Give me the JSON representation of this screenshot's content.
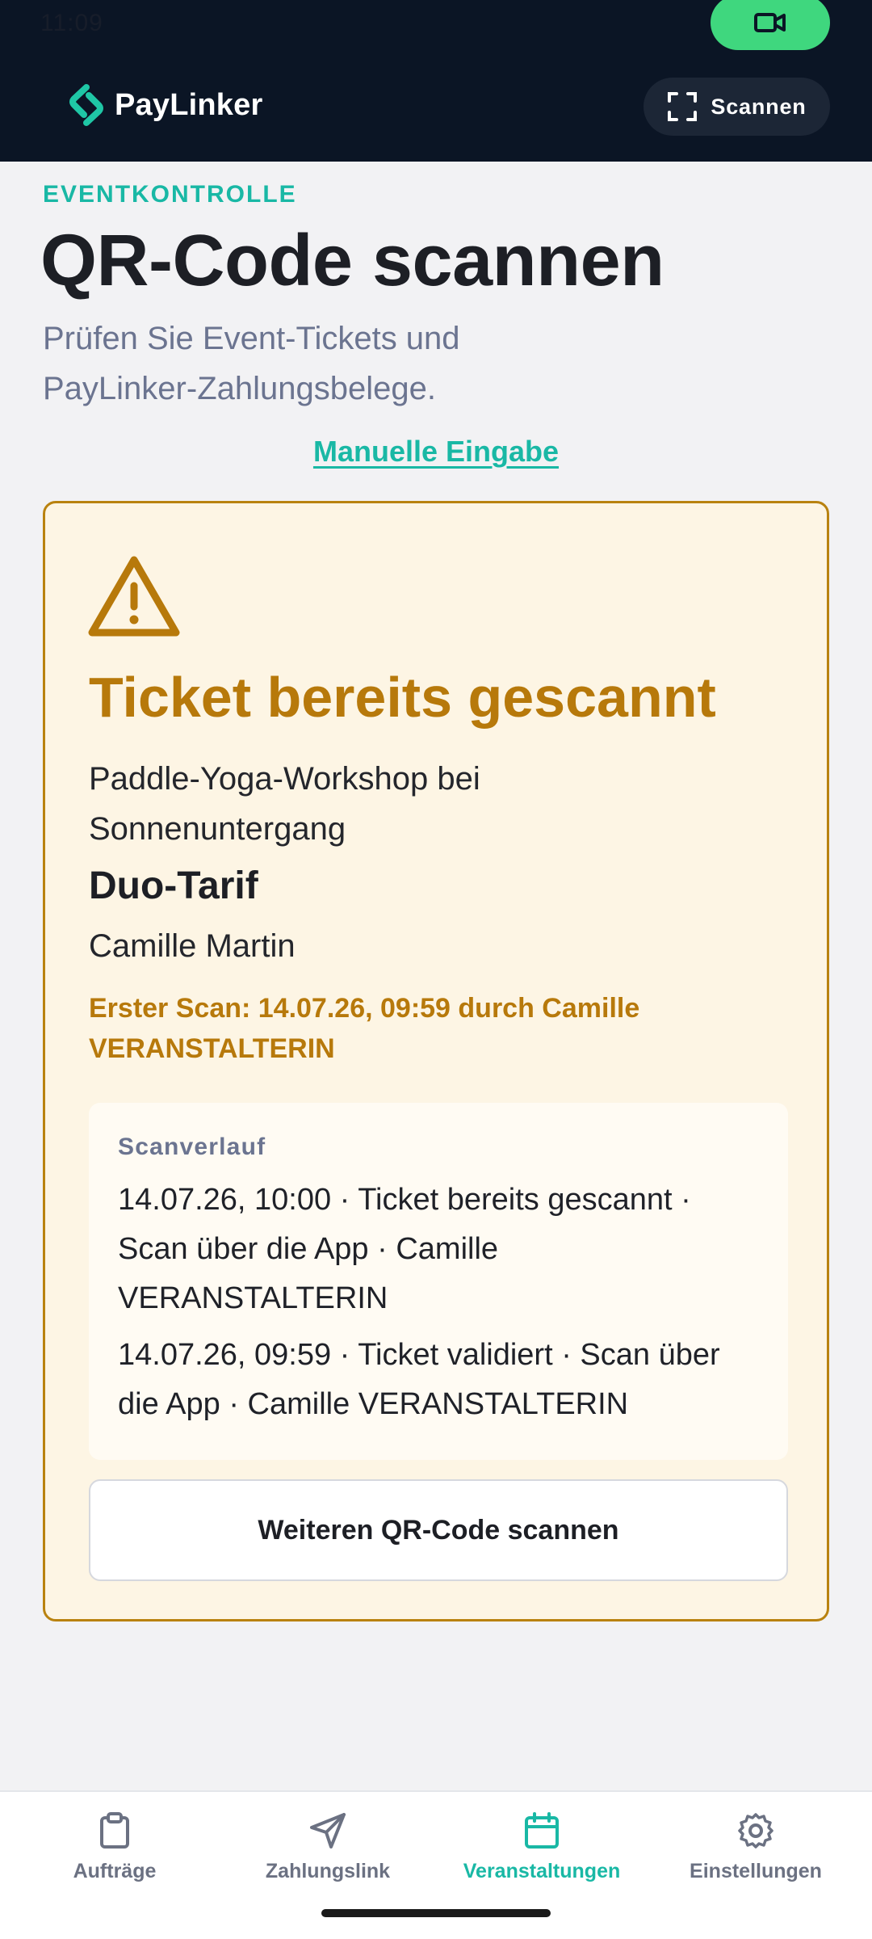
{
  "status_bar": {
    "time": "11:09"
  },
  "header": {
    "brand": "PayLinker",
    "scan_button_label": "Scannen",
    "icons": {
      "logo": "paylinker-logo-icon",
      "scan": "scan-frame-icon",
      "camera": "video-camera-icon"
    },
    "colors": {
      "background": "#0b1525",
      "camera_pill": "#3fd77e"
    }
  },
  "intro": {
    "eyebrow": "EVENTKONTROLLE",
    "title": "QR-Code scannen",
    "subtitle": "Prüfen Sie Event-Tickets und PayLinker-Zahlungsbelege.",
    "manual_link": "Manuelle Eingabe"
  },
  "result": {
    "icon": "warning-triangle-icon",
    "title": "Ticket bereits gescannt",
    "event_name": "Paddle-Yoga-Workshop bei Sonnenuntergang",
    "tariff": "Duo-Tarif",
    "holder": "Camille Martin",
    "first_scan": "Erster Scan: 14.07.26, 09:59 durch Camille VERANSTALTERIN",
    "history": {
      "label": "Scanverlauf",
      "entries": [
        "14.07.26, 10:00 · Ticket bereits gescannt · Scan über die App · Camille VERANSTALTERIN",
        "14.07.26, 09:59 · Ticket validiert · Scan über die App · Camille VERANSTALTERIN"
      ]
    },
    "scan_again_label": "Weiteren QR-Code scannen",
    "colors": {
      "accent": "#b7790b",
      "background": "#fdf5e4"
    }
  },
  "bottom_nav": {
    "items": [
      {
        "label": "Aufträge",
        "icon": "clipboard-icon",
        "active": false
      },
      {
        "label": "Zahlungslink",
        "icon": "send-icon",
        "active": false
      },
      {
        "label": "Veranstaltungen",
        "icon": "calendar-icon",
        "active": true
      },
      {
        "label": "Einstellungen",
        "icon": "gear-icon",
        "active": false
      }
    ],
    "active_color": "#19b8a5"
  }
}
